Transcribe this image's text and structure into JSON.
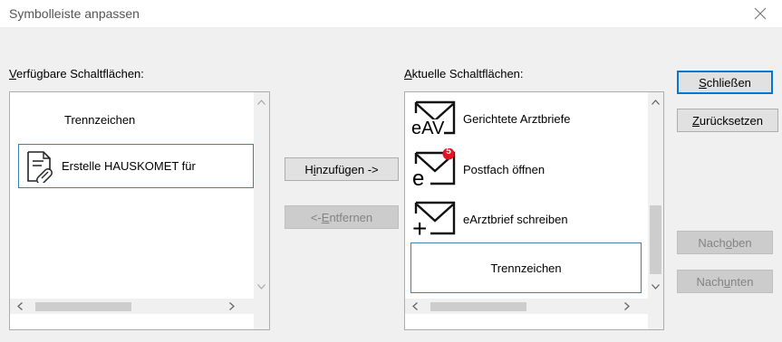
{
  "window": {
    "title": "Symbolleiste anpassen"
  },
  "available": {
    "label_prefix": "V",
    "label_rest": "erfügbare Schaltflächen:",
    "items": [
      {
        "label": "Trennzeichen"
      },
      {
        "label": "Erstelle HAUSKOMET für",
        "icon": "document-link-icon"
      }
    ]
  },
  "current": {
    "label_prefix": "A",
    "label_rest": "ktuelle Schaltflächen:",
    "items": [
      {
        "label": "Gerichtete Arztbriefe",
        "icon_text": "eAV",
        "icon": "envelope-eav-icon"
      },
      {
        "label": "Postfach öffnen",
        "icon_text": "e",
        "icon": "envelope-e-notification-icon",
        "badge": "5"
      },
      {
        "label": "eArztbrief schreiben",
        "icon_text": "+",
        "icon": "envelope-plus-icon"
      },
      {
        "label": "Trennzeichen"
      }
    ]
  },
  "buttons": {
    "add": {
      "pre": "H",
      "u": "i",
      "post": "nzufügen ->"
    },
    "remove": {
      "pre": "<- ",
      "u": "E",
      "post": "ntfernen"
    },
    "close": {
      "pre": "",
      "u": "S",
      "post": "chließen"
    },
    "reset": {
      "pre": "",
      "u": "Z",
      "post": "urücksetzen"
    },
    "up": {
      "pre": "Nach ",
      "u": "o",
      "post": "ben"
    },
    "down": {
      "pre": "Nach ",
      "u": "u",
      "post": "nten"
    }
  },
  "colors": {
    "selection_border": "#3c7fb1",
    "default_button_border": "#0078d7",
    "badge": "#e81123"
  }
}
